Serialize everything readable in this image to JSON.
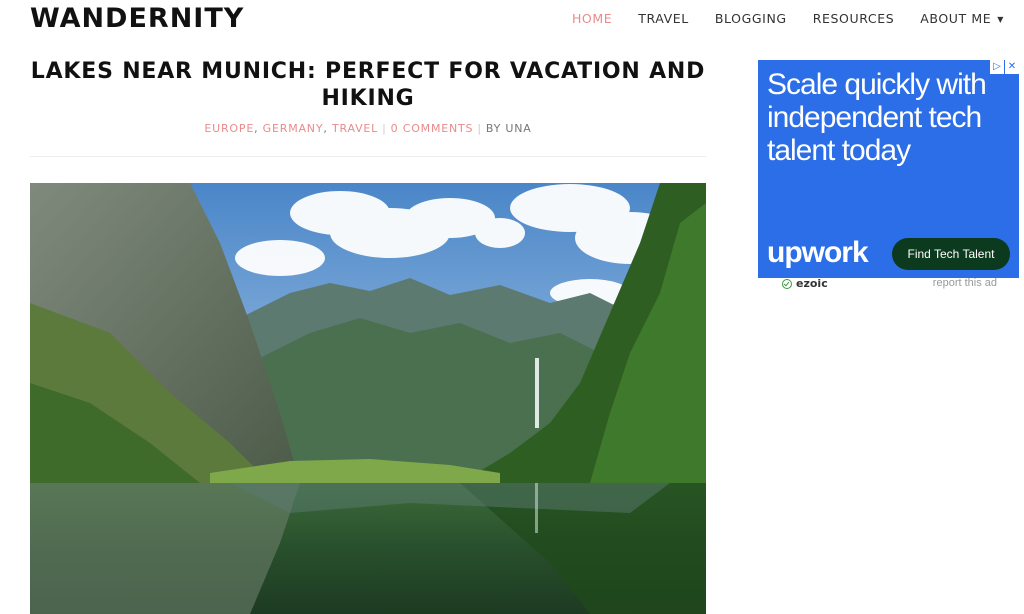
{
  "site": {
    "logo": "WANDERNITY"
  },
  "nav": {
    "items": [
      {
        "label": "HOME",
        "active": true
      },
      {
        "label": "TRAVEL",
        "active": false
      },
      {
        "label": "BLOGGING",
        "active": false
      },
      {
        "label": "RESOURCES",
        "active": false
      },
      {
        "label": "ABOUT ME",
        "active": false,
        "has_dropdown": true
      }
    ],
    "dropdown_icon": "caret-down-icon"
  },
  "post": {
    "title": "LAKES NEAR MUNICH: PERFECT FOR VACATION AND HIKING",
    "categories": [
      "EUROPE",
      "GERMANY",
      "TRAVEL"
    ],
    "comments": "0 COMMENTS",
    "author": "BY UNA",
    "hero_alt": "Mountain lake with forest and reflection"
  },
  "ad": {
    "headline": "Scale quickly with independent tech talent today",
    "brand": "upwork",
    "cta": "Find Tech Talent",
    "choices_icons": [
      "ad-choices-icon",
      "close-icon"
    ],
    "provider": "ezoic",
    "report": "report this ad"
  },
  "colors": {
    "accent": "#e98b8b",
    "ad_background": "#2b6ee8",
    "ad_cta_background": "#0c3a1e"
  }
}
